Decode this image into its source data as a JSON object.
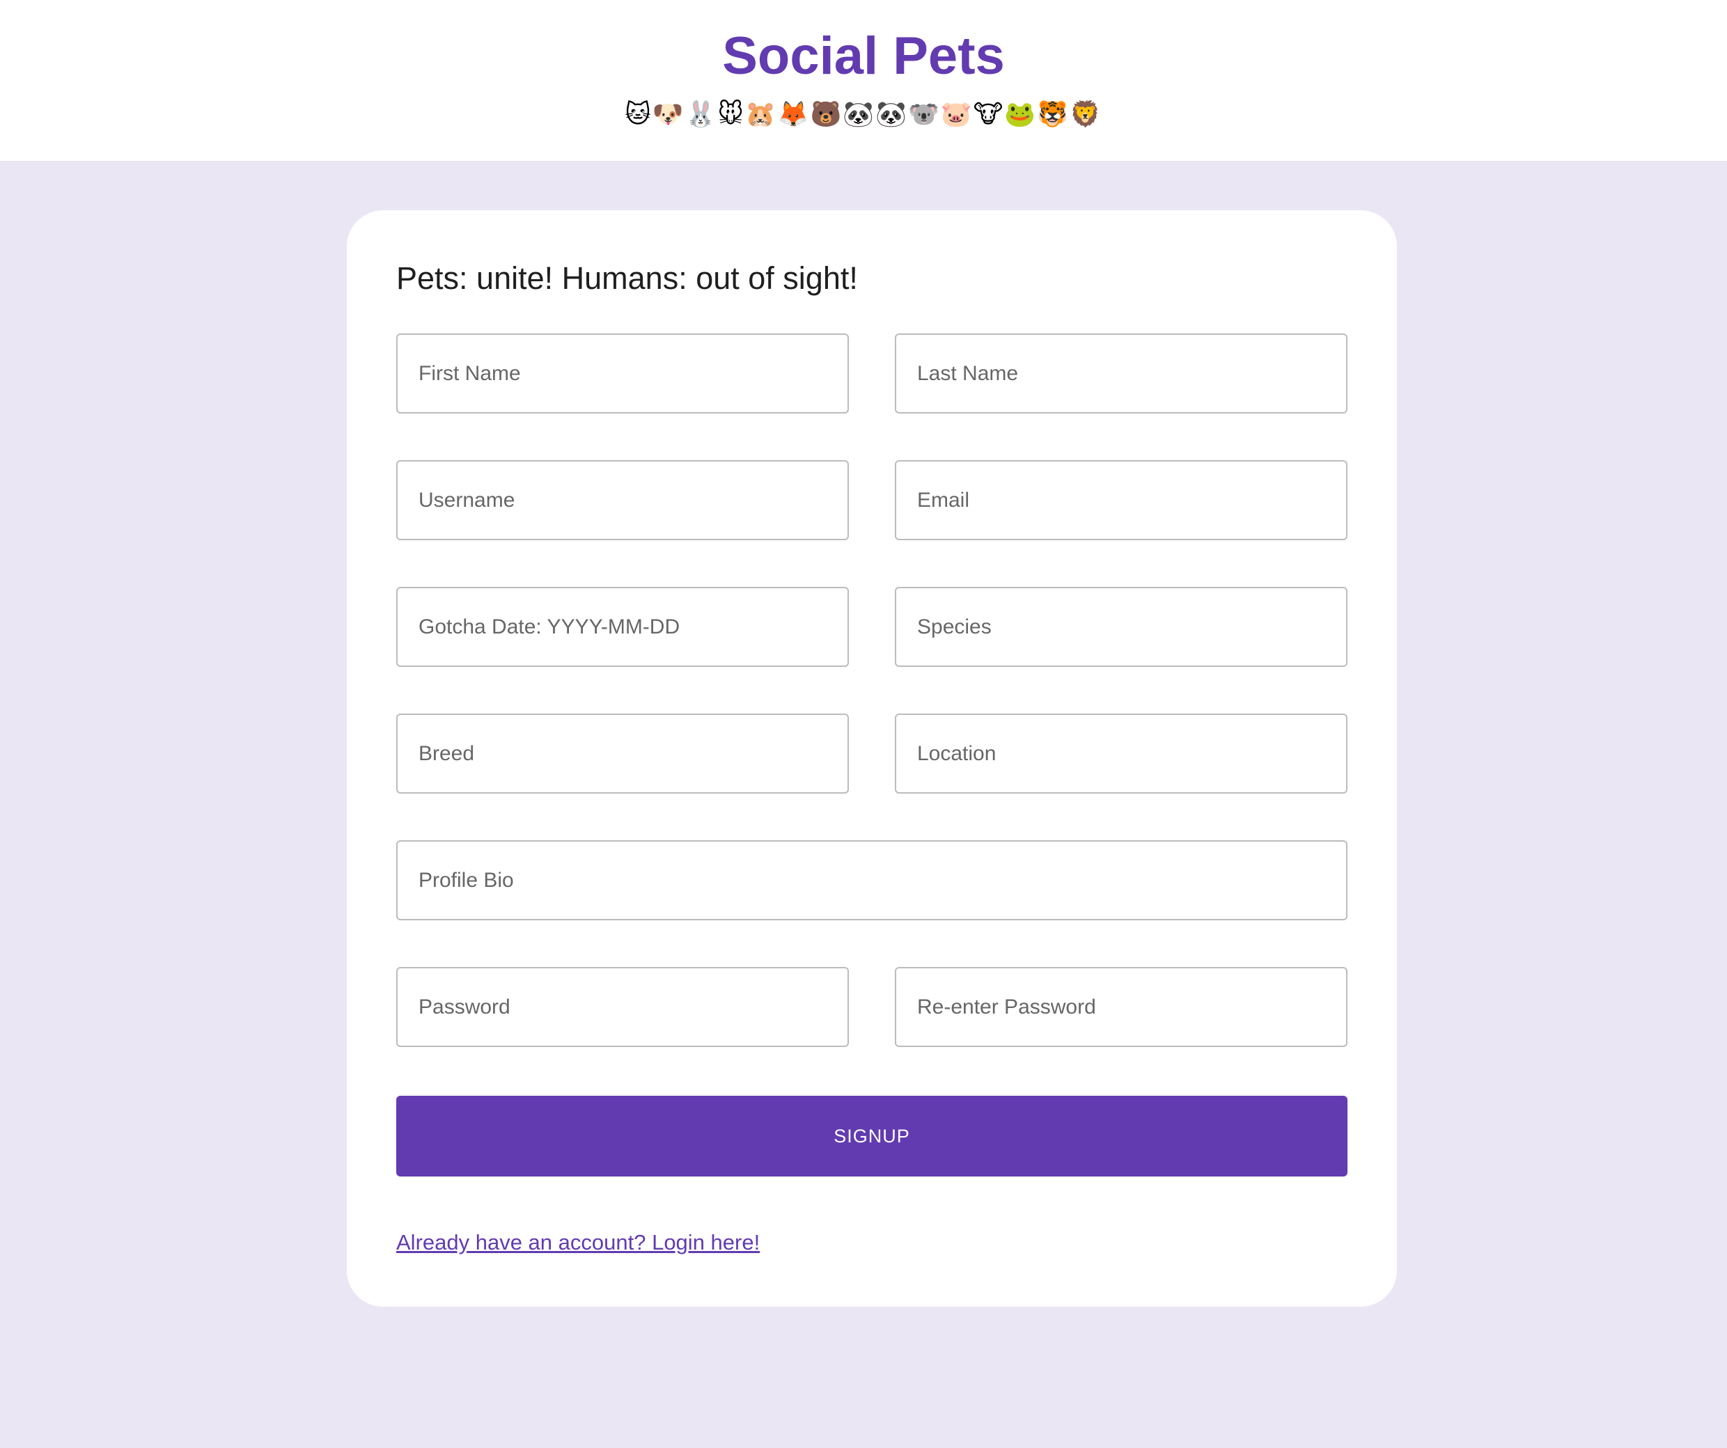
{
  "header": {
    "title": "Social Pets",
    "emoji_strip": "🐱🐶🐰🐭🐹🦊🐻🐼🐼🐨🐷🐮🐸🐯🦁"
  },
  "form": {
    "heading": "Pets: unite! Humans: out of sight!",
    "fields": {
      "first_name": "First Name",
      "last_name": "Last Name",
      "username": "Username",
      "email": "Email",
      "gotcha_date": "Gotcha Date: YYYY-MM-DD",
      "species": "Species",
      "breed": "Breed",
      "location": "Location",
      "profile_bio": "Profile Bio",
      "password": "Password",
      "reenter_password": "Re-enter Password"
    },
    "signup_label": "SIGNUP",
    "login_link": "Already have an account? Login here!"
  },
  "colors": {
    "accent": "#623bb0",
    "background": "#eae6f4"
  }
}
